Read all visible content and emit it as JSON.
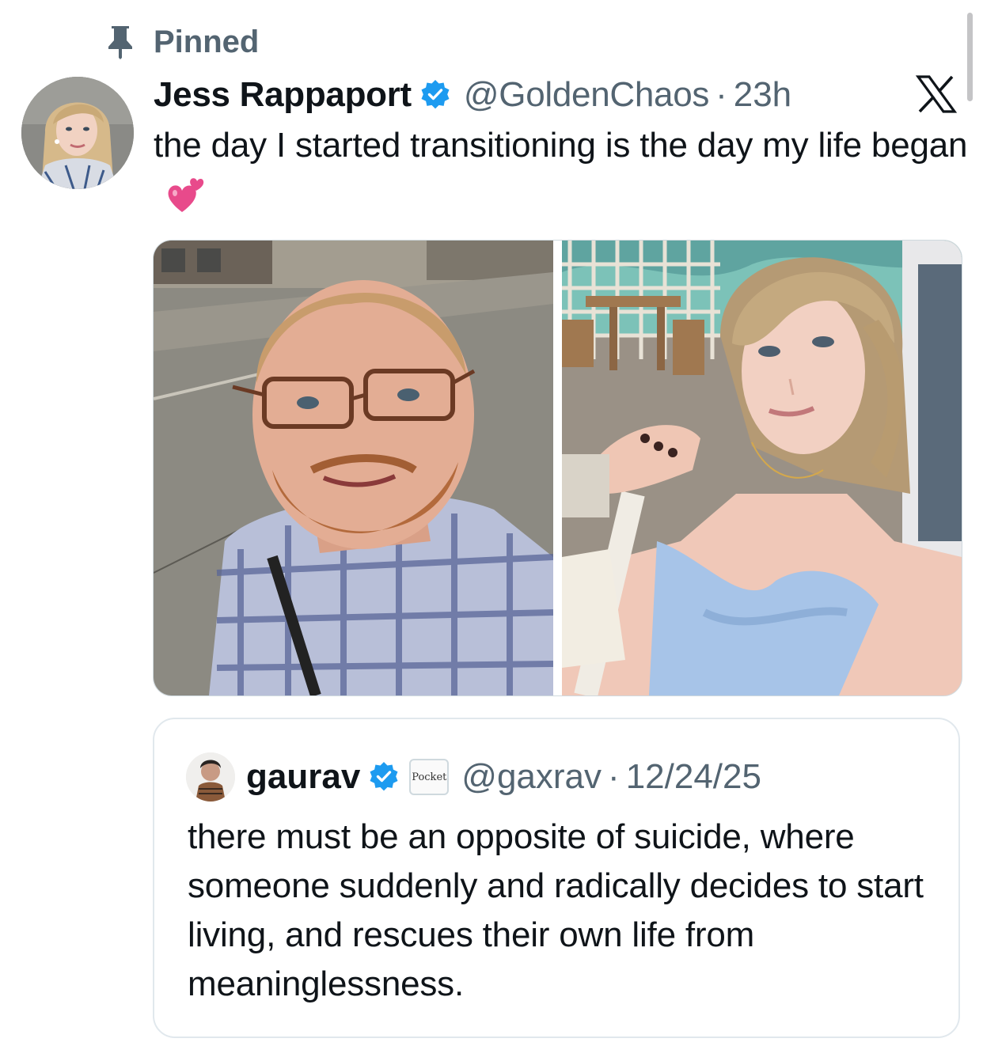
{
  "pinned": {
    "icon": "pin-icon",
    "label": "Pinned"
  },
  "tweet": {
    "author": {
      "display_name": "Jess Rappaport",
      "verified": true,
      "handle": "@GoldenChaos",
      "avatar": "profile-photo"
    },
    "separator": "·",
    "time": "23h",
    "platform_icon": "x-logo-icon",
    "text": "the day I started transitioning is the day my life began",
    "emoji": "two-hearts-emoji",
    "media": [
      {
        "name": "before-photo",
        "description_icon": "photo"
      },
      {
        "name": "after-photo",
        "description_icon": "photo"
      }
    ]
  },
  "quote": {
    "author": {
      "display_name": "gaurav",
      "verified": true,
      "affiliate_badge": "Pocket",
      "handle": "@gaxrav"
    },
    "separator": "·",
    "date": "12/24/25",
    "text": "there must be an opposite of suicide, where someone suddenly and radically decides to start living, and rescues their own life from meaninglessness."
  },
  "colors": {
    "text_primary": "#0f1419",
    "text_secondary": "#536471",
    "verified_blue": "#1d9bf0",
    "border": "#e1e8ed",
    "emoji_pink": "#e84a8b"
  }
}
